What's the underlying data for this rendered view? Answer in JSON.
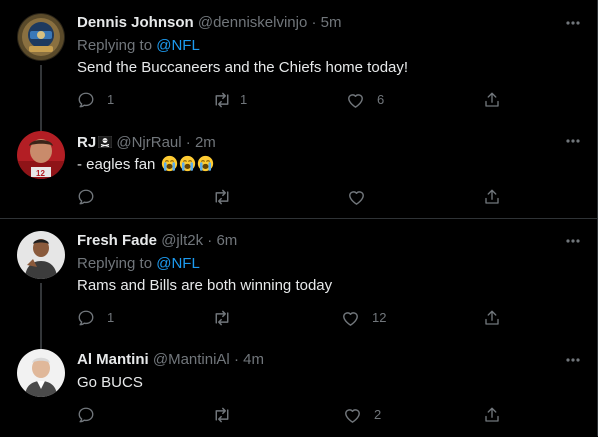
{
  "tweets": [
    {
      "name": "Dennis Johnson",
      "handle": "@denniskelvinjo",
      "time": "5m",
      "replying_label": "Replying to",
      "replying_to": "@NFL",
      "text": "Send the Buccaneers and the Chiefs home today!",
      "replies": "1",
      "retweets": "1",
      "likes": "6"
    },
    {
      "name": "RJ",
      "name_badge_icon": "pirate-flag-icon",
      "handle": "@NjrRaul",
      "time": "2m",
      "text": "- eagles fan",
      "text_emoji": "loudly-crying-face-icon",
      "replies": "",
      "retweets": "",
      "likes": ""
    },
    {
      "name": "Fresh Fade",
      "handle": "@jlt2k",
      "time": "6m",
      "replying_label": "Replying to",
      "replying_to": "@NFL",
      "text": "Rams and Bills are both winning today",
      "replies": "1",
      "retweets": "",
      "likes": "12"
    },
    {
      "name": "Al Mantini",
      "handle": "@MantiniAl",
      "time": "4m",
      "text": "Go BUCS",
      "replies": "",
      "retweets": "",
      "likes": "2"
    }
  ],
  "separator": "·",
  "colors": {
    "background": "#000000",
    "text": "#e7e9ea",
    "muted": "#71767b",
    "accent": "#1d9bf0",
    "border": "#2f3336"
  }
}
